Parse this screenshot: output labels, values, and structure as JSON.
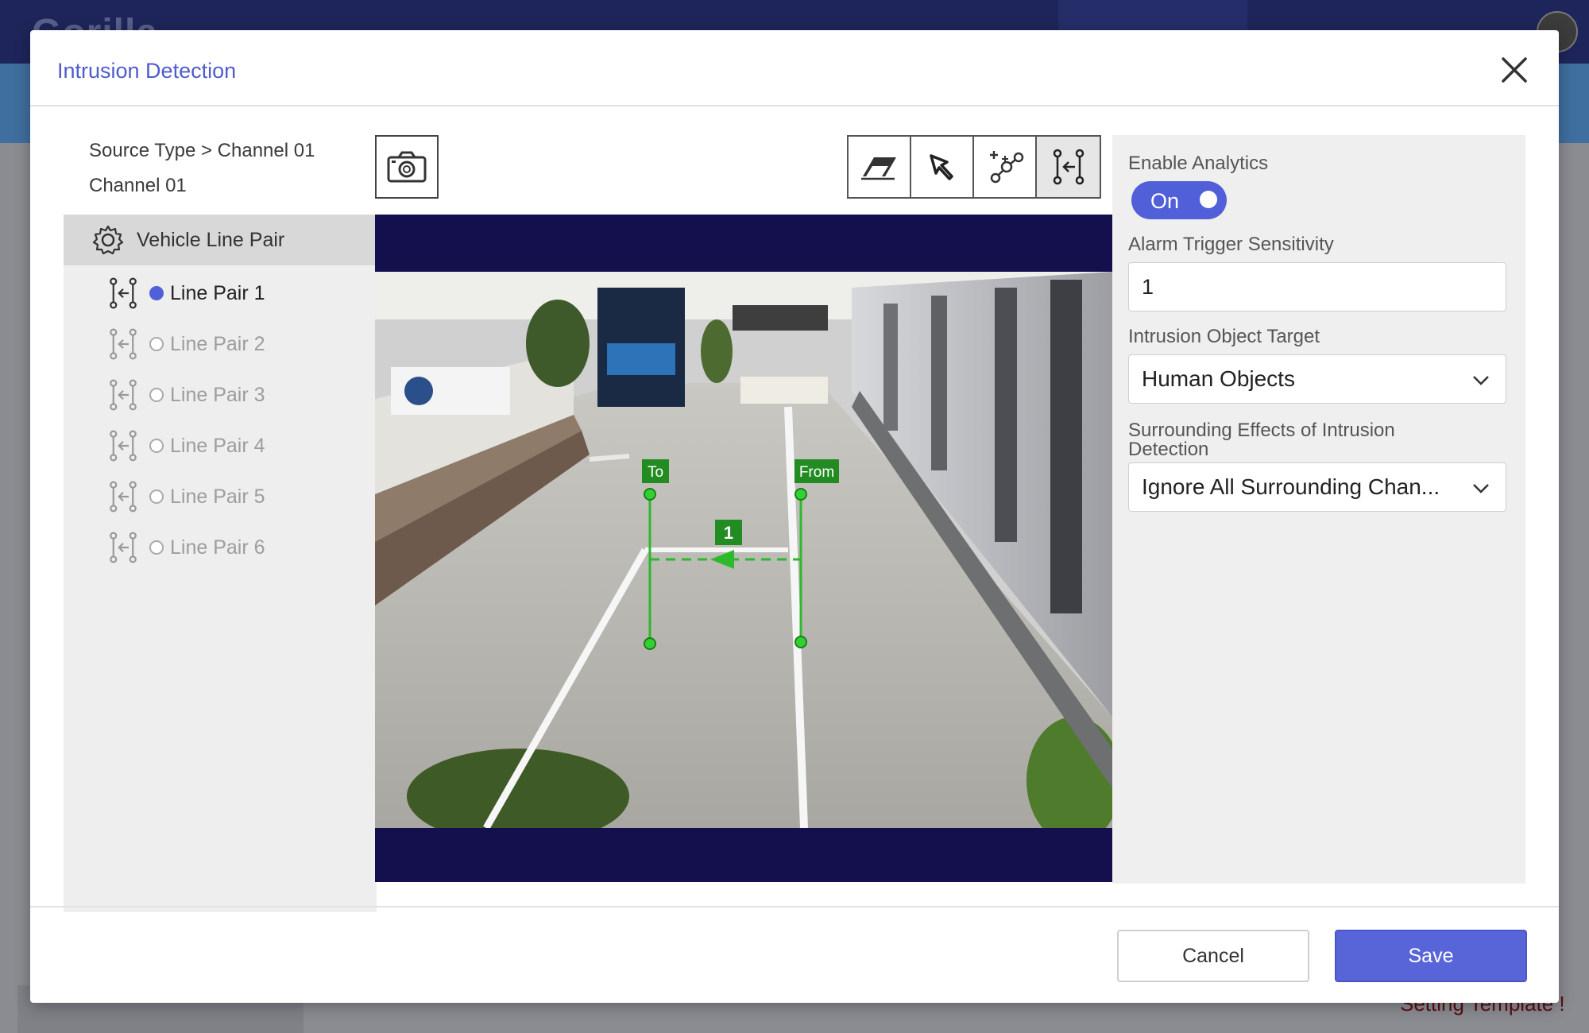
{
  "background": {
    "logo": "Gorilla",
    "footer_text": "Setting Template !"
  },
  "modal": {
    "title": "Intrusion Detection",
    "close_icon": "close-icon"
  },
  "source": {
    "path": "Source Type > Channel 01 Channel 01"
  },
  "tree": {
    "parent_label": "Vehicle Line Pair",
    "items": [
      {
        "label": "Line Pair 1",
        "active": true
      },
      {
        "label": "Line Pair 2",
        "active": false
      },
      {
        "label": "Line Pair 3",
        "active": false
      },
      {
        "label": "Line Pair 4",
        "active": false
      },
      {
        "label": "Line Pair 5",
        "active": false
      },
      {
        "label": "Line Pair 6",
        "active": false
      }
    ]
  },
  "toolbar": {
    "snapshot_icon": "camera-icon",
    "tools": [
      "eraser-icon",
      "pointer-icon",
      "add-node-icon",
      "line-pair-icon"
    ],
    "selected_tool": "line-pair-icon"
  },
  "video": {
    "label_to": "To",
    "label_from": "From",
    "pair_number": "1",
    "line_color": "#2eb82e"
  },
  "settings": {
    "enable_label": "Enable Analytics",
    "enable_value": "On",
    "sensitivity_label": "Alarm Trigger Sensitivity",
    "sensitivity_value": "1",
    "target_label": "Intrusion Object Target",
    "target_value": "Human Objects",
    "surrounding_label": "Surrounding Effects of Intrusion Detection",
    "surrounding_value": "Ignore All Surrounding Chan..."
  },
  "footer": {
    "cancel_label": "Cancel",
    "save_label": "Save"
  },
  "colors": {
    "accent": "#5160d8",
    "video_bg": "#14104e"
  }
}
